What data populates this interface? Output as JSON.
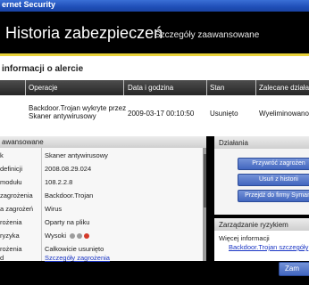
{
  "window": {
    "title": "ernet Security"
  },
  "header": {
    "title": "Historia zabezpieczeń",
    "subtitle": "Szczegóły zaawansowane"
  },
  "info_section": {
    "heading": "informacji o alercie"
  },
  "table": {
    "headers": [
      "Operacje",
      "Data i godzina",
      "Stan",
      "Zalecane działanie"
    ],
    "row": {
      "operation_line1": "Backdoor.Trojan wykryte przez",
      "operation_line2": "Skaner antywirusowy",
      "datetime": "2009-03-17 00:10:50",
      "status": "Usunięto",
      "action": "Wyeliminowano – b"
    }
  },
  "details": {
    "heading": "awansowane",
    "rows": [
      {
        "key": "k",
        "value": "Skaner antywirusowy"
      },
      {
        "key": "definicji",
        "value": "2008.08.29.024"
      },
      {
        "key": "modułu",
        "value": "108.2.2.8"
      },
      {
        "key": "zagrożenia",
        "value": "Backdoor.Trojan"
      },
      {
        "key": "a zagrożeń",
        "value": "Wirus"
      },
      {
        "key": "rożenia",
        "value": "Oparty na pliku"
      },
      {
        "key": "ryzyka",
        "value": "Wysoki"
      },
      {
        "key": "rożenia",
        "value": "Całkowicie usunięto"
      },
      {
        "key": "d",
        "value": "Szczegóły zagrożenia"
      }
    ],
    "risk_dot_colors": [
      "#9c9c9c",
      "#9c9c9c",
      "#d43a2a"
    ]
  },
  "actions": {
    "heading": "Działania",
    "buttons": [
      "Przywróć zagrożen",
      "Usuń z historii",
      "Przejdź do firmy Symant"
    ]
  },
  "risk_mgmt": {
    "heading": "Zarządzanie ryzykiem",
    "more_info": "Więcej informacji",
    "link": "Backdoor.Trojan szczegóły"
  },
  "footer": {
    "close_label": "Zam"
  }
}
